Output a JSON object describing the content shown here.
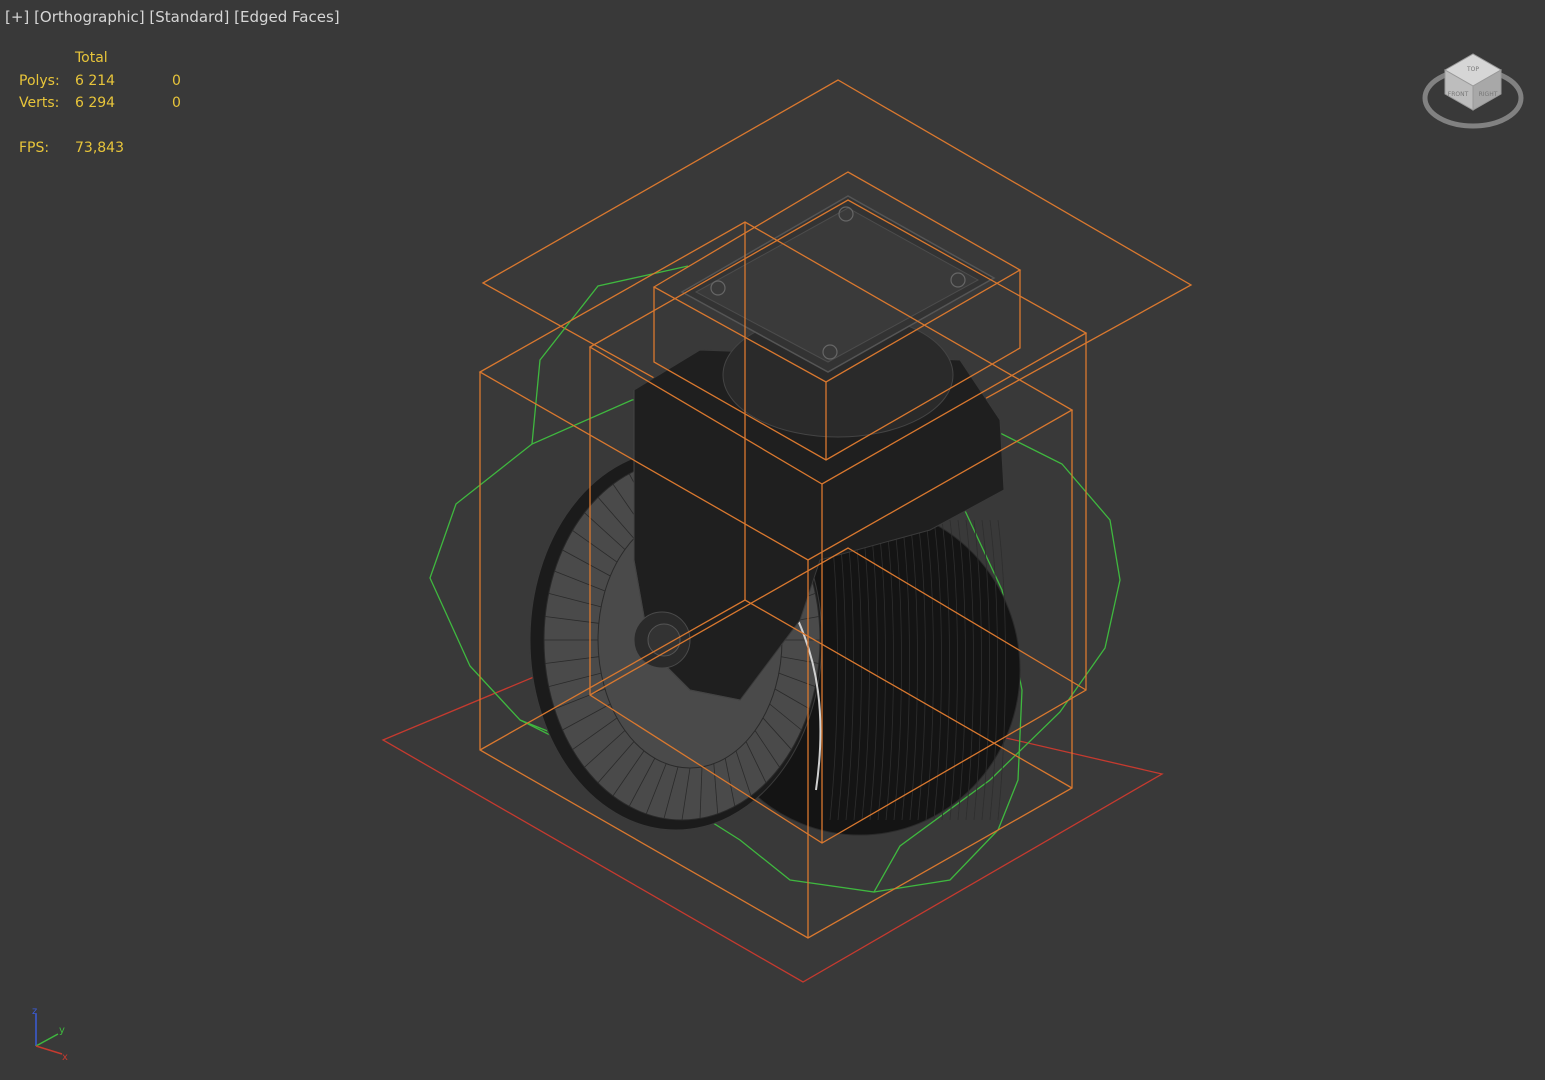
{
  "viewport": {
    "menu_plus": "[+]",
    "view_mode": "[Orthographic]",
    "shading": "[Standard]",
    "display": "[Edged Faces]"
  },
  "stats": {
    "header_total": "Total",
    "polys_label": "Polys:",
    "polys_total": "6 214",
    "polys_selected": "0",
    "verts_label": "Verts:",
    "verts_total": "6 294",
    "verts_selected": "0",
    "fps_label": "FPS:",
    "fps_value": "73,843"
  },
  "viewcube": {
    "face_top": "TOP",
    "face_front": "FRONT",
    "face_right": "RIGHT"
  },
  "axis": {
    "x": "x",
    "y": "y",
    "z": "z"
  },
  "colors": {
    "background": "#393939",
    "stats_text": "#e8c53a",
    "label_text": "#d6d6d6",
    "bbox": "#d9782f",
    "helper_circle": "#3fb83f",
    "grid_plane": "#c53a2f",
    "model": "#1e1e1e"
  },
  "icons": [
    "viewcube-icon",
    "axis-tripod-icon"
  ]
}
